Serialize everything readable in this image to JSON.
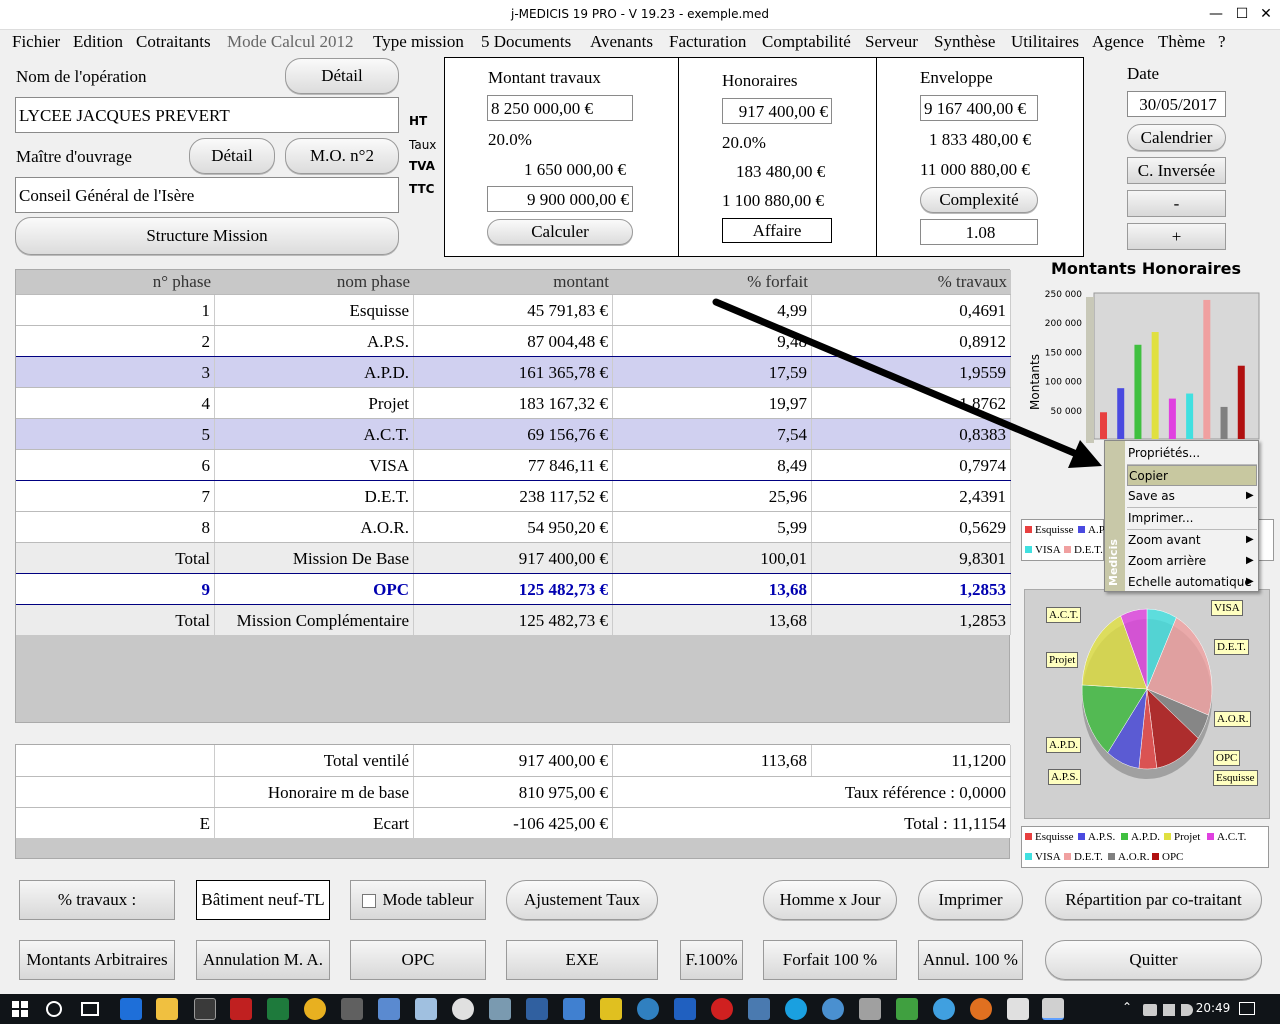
{
  "window": {
    "title": "j-MEDICIS 19 PRO - V 19.23 - exemple.med"
  },
  "menu": [
    "Fichier",
    "Edition",
    "Cotraitants",
    "Mode Calcul 2012",
    "Type mission",
    "5 Documents",
    "Avenants",
    "Facturation",
    "Comptabilité",
    "Serveur",
    "Synthèse",
    "Utilitaires",
    "Agence",
    "Thème",
    "?"
  ],
  "operation": {
    "label": "Nom de l'opération",
    "detail": "Détail",
    "value": "LYCEE JACQUES PREVERT"
  },
  "owner": {
    "label": "Maître d'ouvrage",
    "detail": "Détail",
    "mo2": "M.O. n°2",
    "value": "Conseil Général de l'Isère"
  },
  "structure_btn": "Structure Mission",
  "side_labels": {
    "ht": "HT",
    "taux": "Taux",
    "tva": "TVA",
    "ttc": "TTC"
  },
  "travaux": {
    "title": "Montant travaux",
    "ht": "8 250 000,00 €",
    "taux": "20.0%",
    "tva": "1 650 000,00 €",
    "ttc": "9 900 000,00 €",
    "calc": "Calculer"
  },
  "honoraires": {
    "title": "Honoraires",
    "ht": "917 400,00 €",
    "taux": "20.0%",
    "tva": "183 480,00 €",
    "ttc": "1 100 880,00 €",
    "affaire": "Affaire"
  },
  "enveloppe": {
    "title": "Enveloppe",
    "ht": "9 167 400,00 €",
    "tva": "1 833 480,00 €",
    "ttc": "11 000 880,00 €",
    "complexite": "Complexité",
    "coef": "1.08"
  },
  "date": {
    "title": "Date",
    "value": "30/05/2017",
    "calendrier": "Calendrier",
    "inversee": "C. Inversée",
    "minus": "-",
    "plus": "+"
  },
  "table": {
    "headers": [
      "n° phase",
      "nom phase",
      "montant",
      "% forfait",
      "% travaux"
    ],
    "rows": [
      [
        "1",
        "Esquisse",
        "45 791,83 €",
        "4,99",
        "0,4691"
      ],
      [
        "2",
        "A.P.S.",
        "87 004,48 €",
        "9,48",
        "0,8912"
      ],
      [
        "3",
        "A.P.D.",
        "161 365,78 €",
        "17,59",
        "1,9559"
      ],
      [
        "4",
        "Projet",
        "183 167,32 €",
        "19,97",
        "1,8762"
      ],
      [
        "5",
        "A.C.T.",
        "69 156,76 €",
        "7,54",
        "0,8383"
      ],
      [
        "6",
        "VISA",
        "77 846,11 €",
        "8,49",
        "0,7974"
      ],
      [
        "7",
        "D.E.T.",
        "238 117,52 €",
        "25,96",
        "2,4391"
      ],
      [
        "8",
        "A.O.R.",
        "54 950,20 €",
        "5,99",
        "0,5629"
      ],
      [
        "Total",
        "Mission De Base",
        "917 400,00 €",
        "100,01",
        "9,8301"
      ],
      [
        "9",
        "OPC",
        "125 482,73 €",
        "13,68",
        "1,2853"
      ],
      [
        "Total",
        "Mission Complémentaire",
        "125 482,73 €",
        "13,68",
        "1,2853"
      ]
    ]
  },
  "summary": {
    "r1": [
      "",
      "Total ventilé",
      "917 400,00 €",
      "113,68",
      "11,1200"
    ],
    "r2": [
      "",
      "Honoraire m de base",
      "810 975,00 €",
      "Taux référence : 0,0000"
    ],
    "r3": [
      "E",
      "Ecart",
      "-106 425,00 €",
      "Total : 11,1154"
    ]
  },
  "chart_data": [
    {
      "type": "bar",
      "title": "Montants Honoraires",
      "ylabel": "Montants",
      "ylim": [
        0,
        250000
      ],
      "yticks": [
        "250 000",
        "200 000",
        "150 000",
        "100 000",
        "50 000"
      ],
      "categories": [
        "Esquisse",
        "A.P.S.",
        "A.P.D.",
        "Projet",
        "A.C.T.",
        "VISA",
        "D.E.T.",
        "A.O.R.",
        "OPC"
      ],
      "values": [
        45791.83,
        87004.48,
        161365.78,
        183167.32,
        69156.76,
        77846.11,
        238117.52,
        54950.2,
        125482.73
      ],
      "colors": [
        "#e84040",
        "#4a4ae0",
        "#40c040",
        "#e0e040",
        "#e040e0",
        "#40e0e0",
        "#f0a0a0",
        "#808080",
        "#b01010"
      ],
      "legend": [
        "Esquisse",
        "A.P",
        "VISA",
        "D.E.T."
      ]
    },
    {
      "type": "pie",
      "categories": [
        "Esquisse",
        "A.P.S.",
        "A.P.D.",
        "Projet",
        "A.C.T.",
        "VISA",
        "D.E.T.",
        "A.O.R.",
        "OPC"
      ],
      "values": [
        45791.83,
        87004.48,
        161365.78,
        183167.32,
        69156.76,
        77846.11,
        238117.52,
        54950.2,
        125482.73
      ],
      "colors": [
        "#e84040",
        "#4a4ae0",
        "#40c040",
        "#e0e040",
        "#e040e0",
        "#40e0e0",
        "#f0a0a0",
        "#808080",
        "#b01010"
      ],
      "legend": [
        "Esquisse",
        "A.P.S.",
        "A.P.D.",
        "Projet",
        "A.C.T.",
        "VISA",
        "D.E.T.",
        "A.O.R.",
        "OPC"
      ]
    }
  ],
  "context_menu": {
    "side": "Medicis",
    "items": [
      "Propriétés...",
      "Copier",
      "Save as",
      "Imprimer...",
      "Zoom avant",
      "Zoom arrière",
      "Echelle automatique"
    ]
  },
  "bottom": {
    "travaux": "% travaux :",
    "batiment": "Bâtiment neuf-TL",
    "mode_tableur": "Mode tableur",
    "ajustement": "Ajustement Taux",
    "homme": "Homme x Jour",
    "imprimer": "Imprimer",
    "repartition": "Répartition par co-traitant",
    "arbitraires": "Montants Arbitraires",
    "annulation": "Annulation M. A.",
    "opc": "OPC",
    "exe": "EXE",
    "f100": "F.100%",
    "forfait": "Forfait 100 %",
    "annul": "Annul. 100 %",
    "quitter": "Quitter"
  },
  "taskbar": {
    "time": "20:49"
  }
}
